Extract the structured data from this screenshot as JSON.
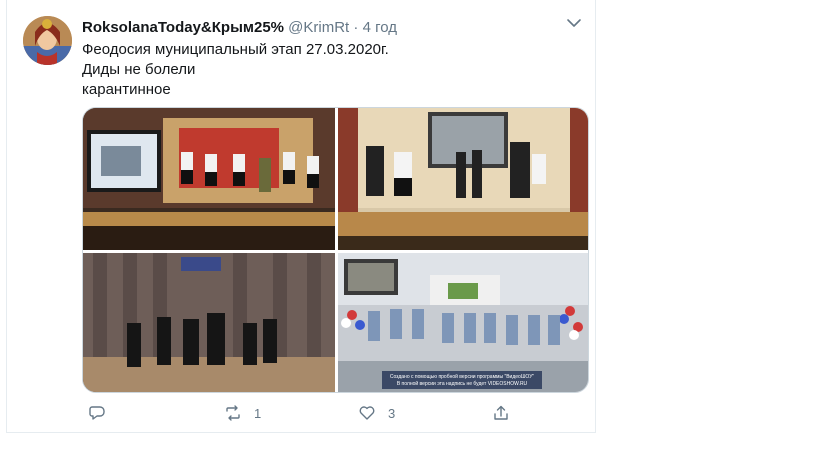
{
  "tweet": {
    "display_name": "RoksolanaToday&Крым25%",
    "handle": "@KrimRt",
    "separator": "·",
    "time": "4 год",
    "lines": [
      "Феодосия муниципальный этап 27.03.2020г.",
      "Диды не болели",
      "карантинное"
    ],
    "watermark_line1": "Создано с помощью пробной версии программы \"ВидеоШОУ\"",
    "watermark_line2": "В полной версии эта надпись не будет VIDEOSHOW.RU"
  },
  "actions": {
    "reply_count": "",
    "retweet_count": "1",
    "like_count": "3"
  },
  "icons": {
    "menu": "chevron-down-icon",
    "reply": "reply-icon",
    "retweet": "retweet-icon",
    "like": "heart-icon",
    "share": "share-icon"
  },
  "colors": {
    "text": "#14171a",
    "secondary": "#657786",
    "border": "#e6ecf0"
  }
}
